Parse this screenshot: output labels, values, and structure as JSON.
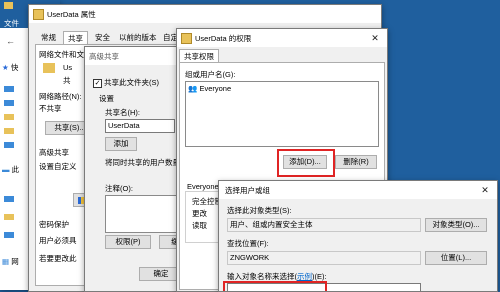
{
  "explorer": {
    "menu_file": "文件",
    "sidebar_labels": [
      "快",
      "此",
      "网"
    ]
  },
  "props": {
    "title": "UserData 属性",
    "tabs": [
      "常规",
      "共享",
      "安全",
      "以前的版本",
      "自定义"
    ],
    "section_share_title": "网络文件和文",
    "item_name": "Us",
    "item_sub": "共",
    "net_path_label": "网络路径(N):",
    "net_path_value": "不共享",
    "share_button": "共享(S)...",
    "advanced_title": "高级共享",
    "advanced_desc": "设置自定义",
    "advanced_button": "高",
    "pw_title": "密码保护",
    "pw_line1": "用户必须具",
    "pw_line2": "若要更改此"
  },
  "adv": {
    "title": "高级共享",
    "share_this": "共享此文件夹(S)",
    "settings": "设置",
    "share_name_label": "共享名(H):",
    "share_name_value": "UserData",
    "add_btn": "添加",
    "limit_label": "将同时共享的用户数量限制",
    "comments_label": "注释(O):",
    "permissions_btn": "权限(P)",
    "cache_btn": "缓",
    "ok_btn": "确定"
  },
  "perm": {
    "title": "UserData 的权限",
    "tab": "共享权限",
    "group_label": "组或用户名(G):",
    "users": [
      "Everyone"
    ],
    "add_btn": "添加(D)...",
    "remove_btn": "删除(R)",
    "perm_for": "Everyone 的",
    "perms": [
      "完全控制",
      "更改",
      "读取"
    ]
  },
  "sel": {
    "title": "选择用户或组",
    "obj_type_label": "选择此对象类型(S):",
    "obj_type_value": "用户、组或内置安全主体",
    "obj_type_btn": "对象类型(O)...",
    "location_label": "查找位置(F):",
    "location_value": "ZNGWORK",
    "location_btn": "位置(L)...",
    "enter_label": "输入对象名称来选择(",
    "enter_link": "示例",
    "enter_label_tail": ")(E):"
  }
}
